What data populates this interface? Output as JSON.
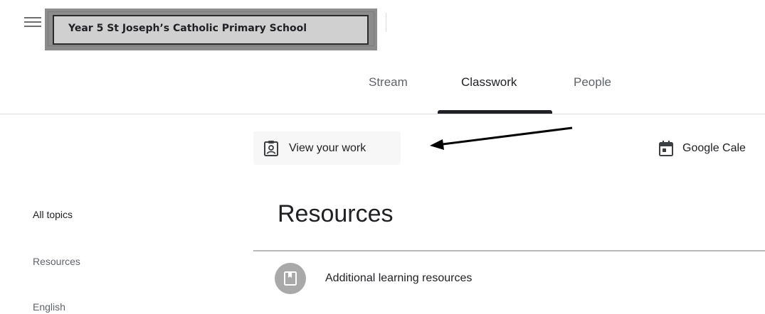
{
  "header": {
    "class_title": "Year 5 St Joseph’s Catholic Primary School",
    "menu_icon": "hamburger-menu-icon"
  },
  "tabs": [
    {
      "label": "Stream",
      "active": false
    },
    {
      "label": "Classwork",
      "active": true
    },
    {
      "label": "People",
      "active": false
    }
  ],
  "toolbar": {
    "view_work_label": "View your work",
    "view_work_icon": "assignment-ind-icon",
    "calendar_label": "Google Cale",
    "calendar_icon": "calendar-icon"
  },
  "sidebar": {
    "topics": [
      {
        "label": "All topics",
        "active": true
      },
      {
        "label": "Resources",
        "active": false
      },
      {
        "label": "English",
        "active": false
      }
    ]
  },
  "main": {
    "section_title": "Resources",
    "items": [
      {
        "label": "Additional learning resources",
        "icon": "material-book-icon"
      }
    ]
  },
  "colors": {
    "accent": "#202124",
    "muted_text": "#5f6368",
    "divider": "#dadce0",
    "material_icon_bg": "#a9a9a9"
  }
}
